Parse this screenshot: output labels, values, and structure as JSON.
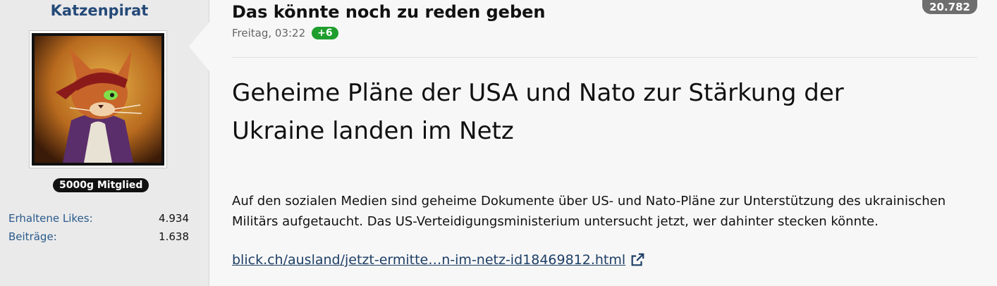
{
  "user": {
    "name": "Katzenpirat",
    "rank": "5000g Mitglied",
    "stats": [
      {
        "label": "Erhaltene Likes:",
        "value": "4.934"
      },
      {
        "label": "Beiträge:",
        "value": "1.638"
      }
    ]
  },
  "post": {
    "thread_title": "Das könnte noch zu reden geben",
    "time": "Freitag, 03:22",
    "reaction_badge": "+6",
    "views_badge": "20.782",
    "headline": "Geheime Pläne der USA und Nato zur Stärkung der Ukraine landen im Netz",
    "body": "Auf den sozialen Medien sind geheime Dokumente über US- und Nato-Pläne zur Unterstützung des ukrainischen Militärs aufgetaucht. Das US-Verteidigungsministerium untersucht jetzt, wer dahinter stecken könnte.",
    "link_text": "blick.ch/ausland/jetzt-ermitte…n-im-netz-id18469812.html",
    "link_icon": "external-link-icon"
  },
  "colors": {
    "username": "#254a78",
    "reaction_badge": "#1f9e2e",
    "views_badge": "#6e6e6e",
    "link": "#1e3f66"
  }
}
